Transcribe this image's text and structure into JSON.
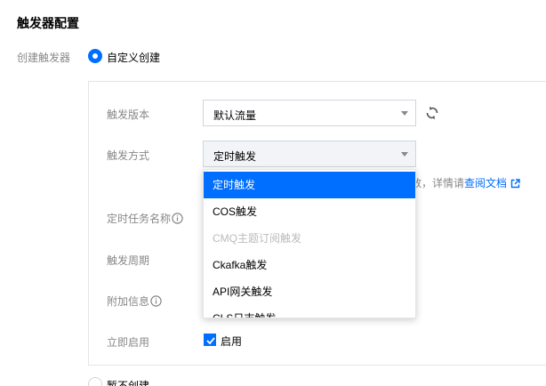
{
  "page": {
    "title": "触发器配置"
  },
  "create_trigger": {
    "label": "创建触发器",
    "custom_option": "自定义创建",
    "no_create_option": "暂不创建"
  },
  "form": {
    "version_label": "触发版本",
    "version_value": "默认流量",
    "method_label": "触发方式",
    "method_value": "定时触发",
    "task_name_label": "定时任务名称",
    "period_label": "触发周期",
    "extra_info_label": "附加信息",
    "enable_label": "立即启用",
    "enable_checkbox_label": "启用",
    "enable_checked": true
  },
  "hint": {
    "text": "数，详情请",
    "link": "查阅文档"
  },
  "dropdown": {
    "items": [
      {
        "label": "定时触发",
        "state": "selected"
      },
      {
        "label": "COS触发",
        "state": "normal"
      },
      {
        "label": "CMQ主题订阅触发",
        "state": "disabled"
      },
      {
        "label": "Ckafka触发",
        "state": "normal"
      },
      {
        "label": "API网关触发",
        "state": "normal"
      },
      {
        "label": "CLS日志触发",
        "state": "normal"
      }
    ]
  },
  "colors": {
    "accent": "#006eff",
    "label_gray": "#888888",
    "border": "#cfd5de",
    "disabled_text": "#bbbbbb"
  },
  "icons": {
    "refresh": "refresh-icon",
    "info": "info-circle-icon",
    "external": "external-link-icon",
    "dropdown_arrow": "caret-down-icon",
    "check": "check-icon"
  }
}
